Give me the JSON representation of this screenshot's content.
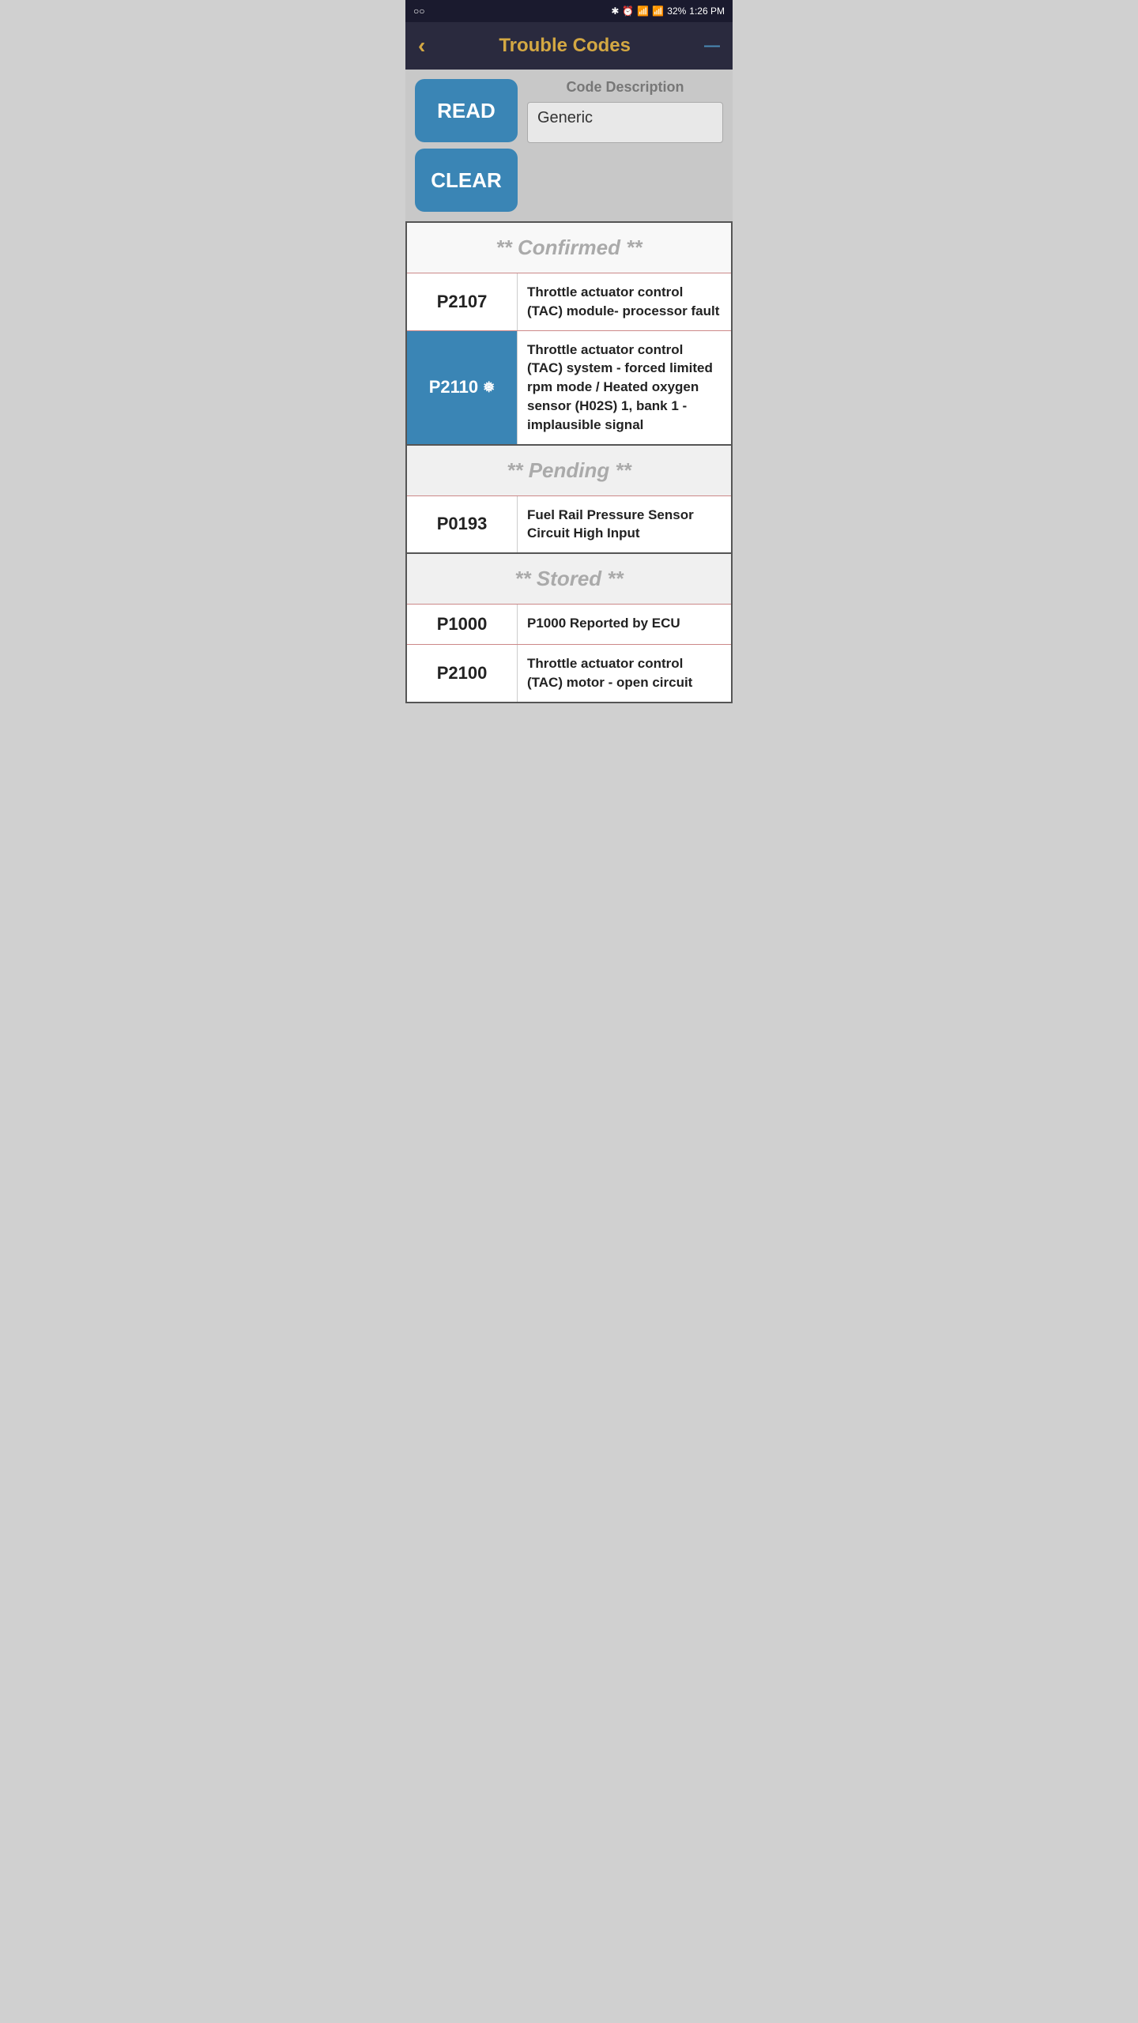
{
  "statusBar": {
    "left": "○○",
    "bluetooth": "⚙",
    "battery": "32%",
    "time": "1:26 PM"
  },
  "header": {
    "backIcon": "‹",
    "title": "Trouble Codes",
    "minimizeIcon": "—"
  },
  "controls": {
    "readLabel": "READ",
    "clearLabel": "CLEAR",
    "codeDescLabel": "Code Description",
    "codeDescValue": "Generic",
    "codeDescPlaceholder": "Generic"
  },
  "sections": {
    "confirmed": {
      "label": "** Confirmed **",
      "rows": [
        {
          "code": "P2107",
          "highlighted": false,
          "description": "Throttle actuator control (TAC) module- processor fault"
        },
        {
          "code": "P2110",
          "highlighted": true,
          "freezeIcon": true,
          "description": "Throttle actuator control (TAC) system - forced limited rpm mode / Heated oxygen sensor (H02S) 1, bank 1 - implausible signal"
        }
      ]
    },
    "pending": {
      "label": "** Pending **",
      "rows": [
        {
          "code": "P0193",
          "highlighted": false,
          "description": "Fuel Rail Pressure Sensor Circuit High Input"
        }
      ]
    },
    "stored": {
      "label": "** Stored **",
      "rows": [
        {
          "code": "P1000",
          "highlighted": false,
          "description": "P1000 Reported by ECU"
        },
        {
          "code": "P2100",
          "highlighted": false,
          "description": "Throttle actuator control (TAC) motor - open circuit"
        }
      ]
    }
  }
}
